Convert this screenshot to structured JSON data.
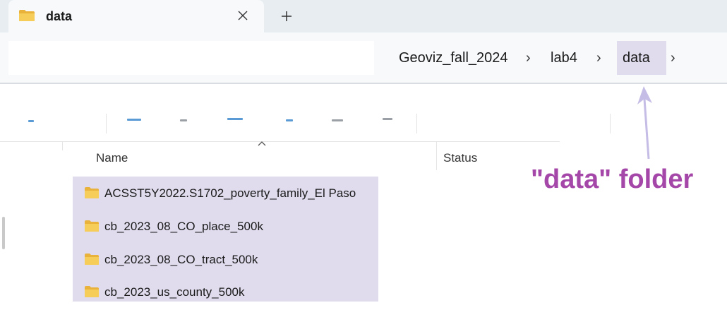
{
  "tab": {
    "title": "data",
    "close_icon": "close-icon",
    "new_tab_icon": "plus-icon"
  },
  "breadcrumb": {
    "items": [
      "Geoviz_fall_2024",
      "lab4",
      "data"
    ],
    "separator": "›"
  },
  "columns": {
    "name": "Name",
    "status": "Status"
  },
  "files": [
    {
      "name": "ACSST5Y2022.S1702_poverty_family_El Paso",
      "icon": "folder-icon"
    },
    {
      "name": "cb_2023_08_CO_place_500k",
      "icon": "folder-icon"
    },
    {
      "name": "cb_2023_08_CO_tract_500k",
      "icon": "folder-icon"
    },
    {
      "name": "cb_2023_us_county_500k",
      "icon": "folder-icon"
    }
  ],
  "annotation": {
    "text": "\"data\" folder",
    "color": "#a447a8"
  },
  "colors": {
    "selection": "#e0dcee",
    "folder_yellow": "#f3c24a",
    "accent_arrow": "#c6bde6"
  }
}
